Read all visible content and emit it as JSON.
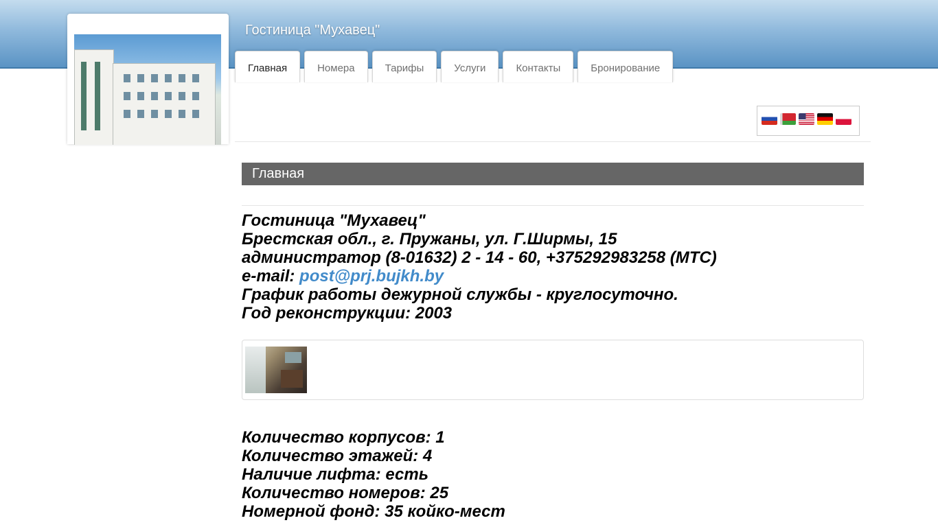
{
  "site": {
    "title": "Гостиница \"Мухавец\""
  },
  "nav": [
    {
      "label": "Главная",
      "active": true
    },
    {
      "label": "Номера",
      "active": false
    },
    {
      "label": "Тарифы",
      "active": false
    },
    {
      "label": "Услуги",
      "active": false
    },
    {
      "label": "Контакты",
      "active": false
    },
    {
      "label": "Бронирование",
      "active": false
    }
  ],
  "languages": [
    "ru",
    "by",
    "en",
    "de",
    "pl"
  ],
  "page": {
    "heading": "Главная"
  },
  "info": {
    "name": "Гостиница \"Мухавец\"",
    "address": "Брестская обл., г. Пружаны, ул. Г.Ширмы, 15",
    "phone": "администратор  (8-01632) 2 - 14 - 60, +375292983258 (МТС)",
    "email_label": "e-mail: ",
    "email": "post@prj.bujkh.by",
    "schedule": "График работы дежурной службы - круглосуточно.",
    "reconstruction": "Год реконструкции: 2003"
  },
  "stats": [
    "Количество корпусов: 1",
    "Количество этажей: 4",
    "Наличие лифта: есть",
    "Количество номеров: 25",
    "Номерной фонд: 35 койко-мест"
  ],
  "colors": {
    "link": "#428bca",
    "header_bar": "#666666",
    "band": "#5a93c4"
  }
}
